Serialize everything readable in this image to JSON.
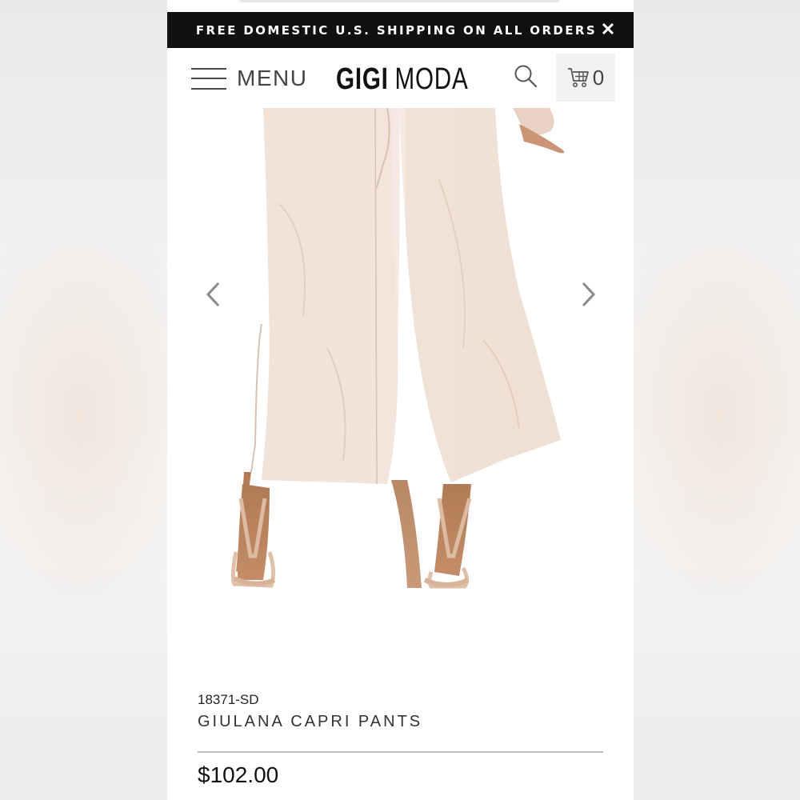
{
  "announcement": {
    "text": "FREE DOMESTIC U.S. SHIPPING ON ALL ORDERS",
    "close_symbol": "✕",
    "background_color": "#111111"
  },
  "header": {
    "menu_label": "MENU",
    "logo_primary": "GIGI",
    "logo_secondary": "MODA",
    "cart_count": "0",
    "icons": [
      "hamburger-icon",
      "search-icon",
      "cart-icon"
    ]
  },
  "gallery": {
    "image_alt": "Woman wearing light pink wide-leg linen capri pants with nude strappy heels",
    "prev_icon": "chevron-left-icon",
    "next_icon": "chevron-right-icon"
  },
  "product": {
    "sku": "18371-SD",
    "title": "GIULANA CAPRI PANTS",
    "price": "$102.00"
  }
}
